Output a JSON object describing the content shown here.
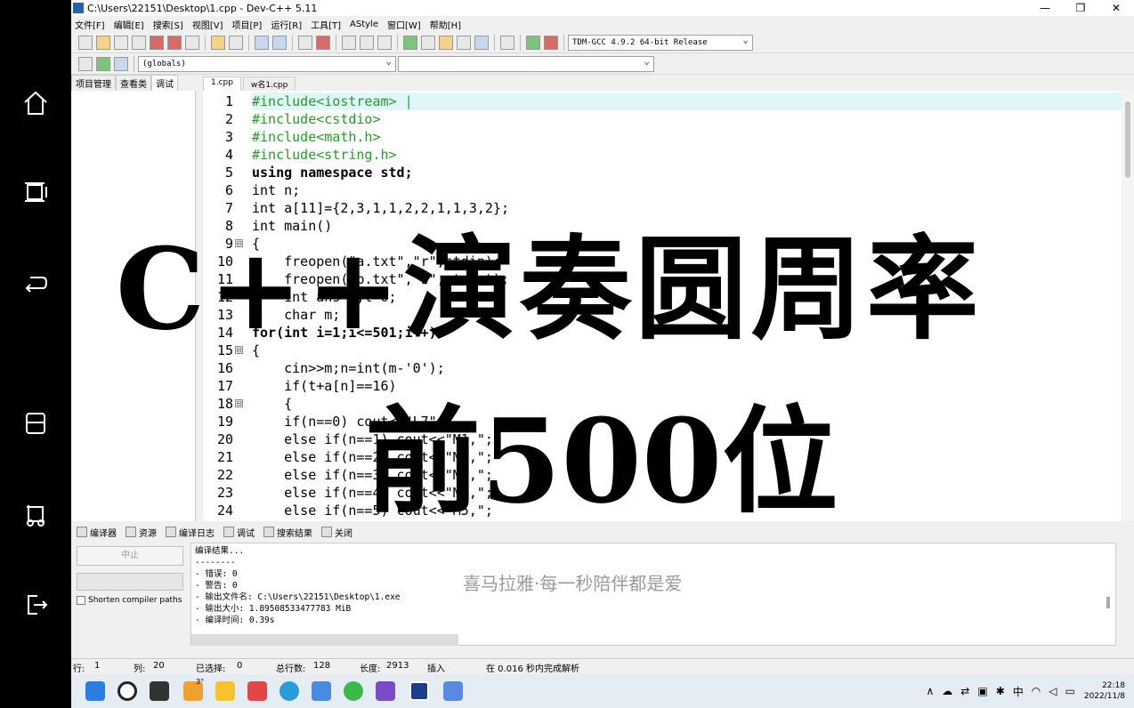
{
  "window": {
    "title": "C:\\Users\\22151\\Desktop\\1.cpp - Dev-C++ 5.11",
    "min": "—",
    "max": "❐",
    "close": "✕"
  },
  "menu": [
    "文件[F]",
    "编辑[E]",
    "搜索[S]",
    "视图[V]",
    "项目[P]",
    "运行[R]",
    "工具[T]",
    "AStyle",
    "窗口[W]",
    "帮助[H]"
  ],
  "compiler_select": "TDM-GCC 4.9.2 64-bit Release",
  "globals_select": "(globals)",
  "left_tabs": [
    "项目管理",
    "查看类",
    "调试"
  ],
  "file_tabs": [
    "1.cpp",
    "w名1.cpp"
  ],
  "line_numbers": [
    "1",
    "2",
    "3",
    "4",
    "5",
    "6",
    "7",
    "8",
    "9",
    "10",
    "11",
    "12",
    "13",
    "14",
    "15",
    "16",
    "17",
    "18",
    "19",
    "20",
    "21",
    "22",
    "23",
    "24"
  ],
  "code_lines": [
    "#include<iostream> |",
    "#include<cstdio>",
    "#include<math.h>",
    "#include<string.h>",
    "using namespace std;",
    "int n;",
    "int a[11]={2,3,1,1,2,2,1,1,3,2};",
    "int main()",
    "{",
    "    freopen(\"a.txt\",\"r\",stdin);",
    "    freopen(\"b.txt\",\"w\",stdout);",
    "    int ans=0,t=0;",
    "    char m;",
    "for(int i=1;i<=501;i++)",
    "{",
    "    cin>>m;n=int(m-'0');",
    "    if(t+a[n]==16)",
    "    {",
    "    if(n==0) cout<<\"L7\";",
    "    else if(n==1) cout<<\"M1,\";",
    "    else if(n==2) cout<<\"M2,\";",
    "    else if(n==3) cout<<\"M3,\";",
    "    else if(n==4) cout<<\"M4,\";",
    "    else if(n==5) cout<<\"M5,\";"
  ],
  "fold_marks": [
    "⊟"
  ],
  "overlay": {
    "line1": "C++演奏圆周率",
    "line2": "前500位"
  },
  "bottom_tabs": [
    "编译器",
    "资源",
    "编译日志",
    "调试",
    "搜索结果",
    "关闭"
  ],
  "abort_label": "中止",
  "shorten_label": "Shorten compiler paths",
  "log_lines": [
    "编译结果...",
    "--------",
    "- 错误: 0",
    "- 警告: 0",
    "- 输出文件名: C:\\Users\\22151\\Desktop\\1.exe",
    "- 输出大小: 1.89508533477783 MiB",
    "- 编译时间: 0.39s"
  ],
  "watermark": "喜马拉雅·每一秒陪伴都是爱",
  "status": {
    "row_label": "行:",
    "row": "1",
    "col_label": "列:",
    "col": "20",
    "sel_label": "已选择:",
    "sel": "0",
    "total_label": "总行数:",
    "total": "128",
    "len_label": "长度:",
    "len": "2913",
    "mode": "插入",
    "parse": "在 0.016 秒内完成解析"
  },
  "taskbar": {
    "ime": "中",
    "time": "22:18",
    "date": "2022/11/8",
    "weather_badge": "3°"
  }
}
